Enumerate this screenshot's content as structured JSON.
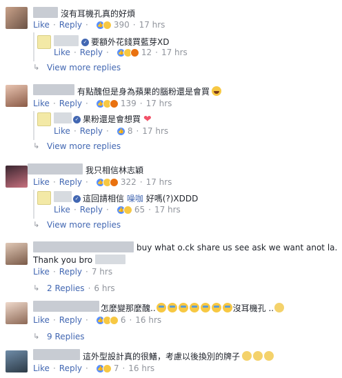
{
  "ui": {
    "like": "Like",
    "reply": "Reply",
    "separator": "·"
  },
  "comments": [
    {
      "text": "沒有耳機孔真的好煩",
      "count": "390",
      "time": "17 hrs",
      "reply": {
        "text": "要額外花錢買藍芽XD",
        "count": "12",
        "time": "17 hrs"
      },
      "more": "View more replies"
    },
    {
      "text": "有點醜但是身為蘋果的腦粉還是會買",
      "count": "139",
      "time": "17 hrs",
      "reply": {
        "text": "果粉還是會想買",
        "count": "8",
        "time": "17 hrs"
      },
      "more": "View more replies"
    },
    {
      "text": "我只相信林志穎",
      "count": "322",
      "time": "17 hrs",
      "reply": {
        "text_a": "這回請相信",
        "text_link": "噪咖",
        "text_b": "好嗎(?)XDDD",
        "count": "65",
        "time": "17 hrs"
      },
      "more": "View more replies"
    },
    {
      "text": "buy what o.ck share us see ask we want anot la.",
      "text2": "Thank you bro",
      "time": "7 hrs",
      "more": "2 Replies",
      "more_time": "6 hrs"
    },
    {
      "text_a": "怎麼變那麼醜",
      "text_b": "沒耳機孔 ..",
      "count": "6",
      "time": "16 hrs",
      "more": "9 Replies"
    },
    {
      "text": "這外型設計真的很鱔，考慮以後換別的牌子",
      "count": "7",
      "time": "16 hrs"
    }
  ]
}
